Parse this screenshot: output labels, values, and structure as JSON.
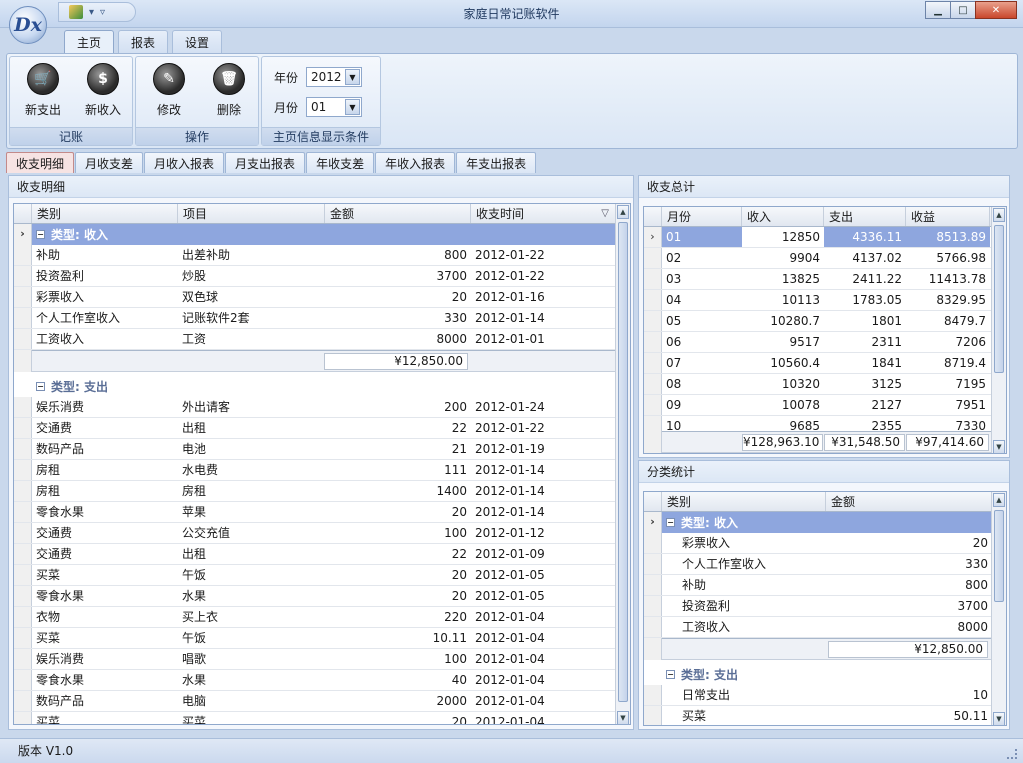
{
  "window": {
    "title": "家庭日常记账软件",
    "logo_text": "Dx"
  },
  "ribbon_tabs": [
    "主页",
    "报表",
    "设置"
  ],
  "ribbon": {
    "groups": [
      {
        "label": "记账",
        "buttons": [
          "新支出",
          "新收入"
        ]
      },
      {
        "label": "操作",
        "buttons": [
          "修改",
          "删除"
        ]
      },
      {
        "label": "主页信息显示条件"
      }
    ],
    "year_label": "年份",
    "year_value": "2012",
    "month_label": "月份",
    "month_value": "01"
  },
  "doc_tabs": [
    "收支明细",
    "月收支差",
    "月收入报表",
    "月支出报表",
    "年收支差",
    "年收入报表",
    "年支出报表"
  ],
  "detail": {
    "title": "收支明细",
    "columns": [
      "类别",
      "项目",
      "金额",
      "收支时间"
    ],
    "income_group": "类型: 收入",
    "income_rows": [
      [
        "补助",
        "出差补助",
        "800",
        "2012-01-22"
      ],
      [
        "投资盈利",
        "炒股",
        "3700",
        "2012-01-22"
      ],
      [
        "彩票收入",
        "双色球",
        "20",
        "2012-01-16"
      ],
      [
        "个人工作室收入",
        "记账软件2套",
        "330",
        "2012-01-14"
      ],
      [
        "工资收入",
        "工资",
        "8000",
        "2012-01-01"
      ]
    ],
    "income_total": "¥12,850.00",
    "expense_group": "类型: 支出",
    "expense_rows": [
      [
        "娱乐消费",
        "外出请客",
        "200",
        "2012-01-24"
      ],
      [
        "交通费",
        "出租",
        "22",
        "2012-01-22"
      ],
      [
        "数码产品",
        "电池",
        "21",
        "2012-01-19"
      ],
      [
        "房租",
        "水电费",
        "111",
        "2012-01-14"
      ],
      [
        "房租",
        "房租",
        "1400",
        "2012-01-14"
      ],
      [
        "零食水果",
        "苹果",
        "20",
        "2012-01-14"
      ],
      [
        "交通费",
        "公交充值",
        "100",
        "2012-01-12"
      ],
      [
        "交通费",
        "出租",
        "22",
        "2012-01-09"
      ],
      [
        "买菜",
        "午饭",
        "20",
        "2012-01-05"
      ],
      [
        "零食水果",
        "水果",
        "20",
        "2012-01-05"
      ],
      [
        "衣物",
        "买上衣",
        "220",
        "2012-01-04"
      ],
      [
        "买菜",
        "午饭",
        "10.11",
        "2012-01-04"
      ],
      [
        "娱乐消费",
        "唱歌",
        "100",
        "2012-01-04"
      ],
      [
        "零食水果",
        "水果",
        "40",
        "2012-01-04"
      ],
      [
        "数码产品",
        "电脑",
        "2000",
        "2012-01-04"
      ],
      [
        "买菜",
        "买菜",
        "20",
        "2012-01-04"
      ]
    ]
  },
  "summary": {
    "title": "收支总计",
    "columns": [
      "月份",
      "收入",
      "支出",
      "收益"
    ],
    "rows": [
      [
        "01",
        "12850",
        "4336.11",
        "8513.89"
      ],
      [
        "02",
        "9904",
        "4137.02",
        "5766.98"
      ],
      [
        "03",
        "13825",
        "2411.22",
        "11413.78"
      ],
      [
        "04",
        "10113",
        "1783.05",
        "8329.95"
      ],
      [
        "05",
        "10280.7",
        "1801",
        "8479.7"
      ],
      [
        "06",
        "9517",
        "2311",
        "7206"
      ],
      [
        "07",
        "10560.4",
        "1841",
        "8719.4"
      ],
      [
        "08",
        "10320",
        "3125",
        "7195"
      ],
      [
        "09",
        "10078",
        "2127",
        "7951"
      ],
      [
        "10",
        "9685",
        "2355",
        "7330"
      ]
    ],
    "totals": [
      "¥128,963.10",
      "¥31,548.50",
      "¥97,414.60"
    ]
  },
  "category": {
    "title": "分类统计",
    "columns": [
      "类别",
      "金额"
    ],
    "income_group": "类型: 收入",
    "income_rows": [
      [
        "彩票收入",
        "20"
      ],
      [
        "个人工作室收入",
        "330"
      ],
      [
        "补助",
        "800"
      ],
      [
        "投资盈利",
        "3700"
      ],
      [
        "工资收入",
        "8000"
      ]
    ],
    "income_total": "¥12,850.00",
    "expense_group": "类型: 支出",
    "expense_rows": [
      [
        "日常支出",
        "10"
      ],
      [
        "买菜",
        "50.11"
      ]
    ]
  },
  "status": {
    "version": "版本 V1.0"
  }
}
